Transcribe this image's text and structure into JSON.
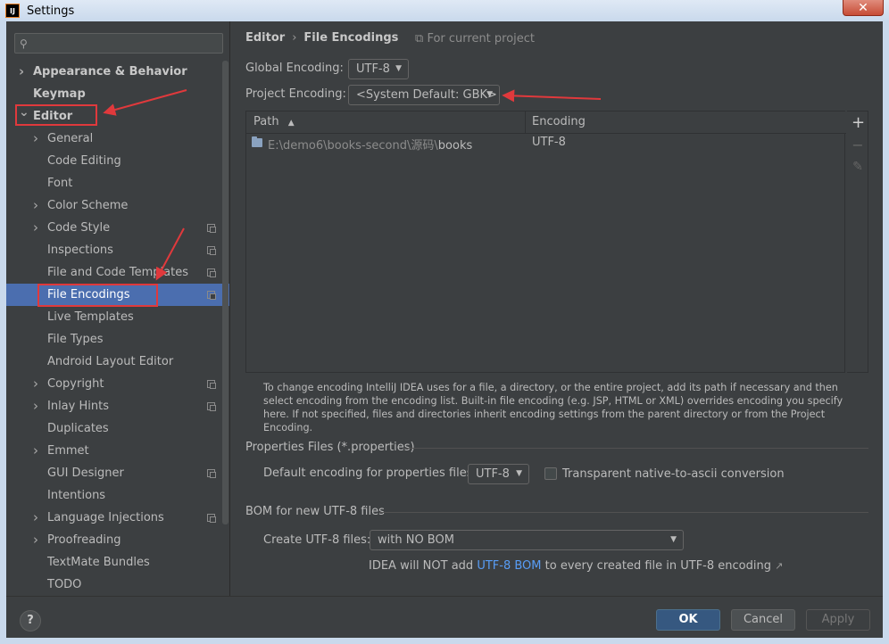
{
  "window": {
    "title": "Settings",
    "app_icon": "IJ",
    "close_label": "✕"
  },
  "search": {
    "placeholder": "",
    "icon": "search-icon"
  },
  "sidebar": {
    "items": [
      {
        "label": "Appearance & Behavior",
        "level": 0,
        "expandable": true,
        "expanded": false,
        "bold": true,
        "copy": false
      },
      {
        "label": "Keymap",
        "level": 0,
        "expandable": false,
        "bold": true,
        "copy": false
      },
      {
        "label": "Editor",
        "level": 0,
        "expandable": true,
        "expanded": true,
        "bold": true,
        "copy": false
      },
      {
        "label": "General",
        "level": 1,
        "expandable": true,
        "expanded": false,
        "copy": false
      },
      {
        "label": "Code Editing",
        "level": 1,
        "expandable": false,
        "copy": false
      },
      {
        "label": "Font",
        "level": 1,
        "expandable": false,
        "copy": false
      },
      {
        "label": "Color Scheme",
        "level": 1,
        "expandable": true,
        "expanded": false,
        "copy": false
      },
      {
        "label": "Code Style",
        "level": 1,
        "expandable": true,
        "expanded": false,
        "copy": true
      },
      {
        "label": "Inspections",
        "level": 1,
        "expandable": false,
        "copy": true
      },
      {
        "label": "File and Code Templates",
        "level": 1,
        "expandable": false,
        "copy": true
      },
      {
        "label": "File Encodings",
        "level": 1,
        "expandable": false,
        "copy": true,
        "selected": true
      },
      {
        "label": "Live Templates",
        "level": 1,
        "expandable": false,
        "copy": false
      },
      {
        "label": "File Types",
        "level": 1,
        "expandable": false,
        "copy": false
      },
      {
        "label": "Android Layout Editor",
        "level": 1,
        "expandable": false,
        "copy": false
      },
      {
        "label": "Copyright",
        "level": 1,
        "expandable": true,
        "expanded": false,
        "copy": true
      },
      {
        "label": "Inlay Hints",
        "level": 1,
        "expandable": true,
        "expanded": false,
        "copy": true
      },
      {
        "label": "Duplicates",
        "level": 1,
        "expandable": false,
        "copy": false
      },
      {
        "label": "Emmet",
        "level": 1,
        "expandable": true,
        "expanded": false,
        "copy": false
      },
      {
        "label": "GUI Designer",
        "level": 1,
        "expandable": false,
        "copy": true
      },
      {
        "label": "Intentions",
        "level": 1,
        "expandable": false,
        "copy": false
      },
      {
        "label": "Language Injections",
        "level": 1,
        "expandable": true,
        "expanded": false,
        "copy": true
      },
      {
        "label": "Proofreading",
        "level": 1,
        "expandable": true,
        "expanded": false,
        "copy": false
      },
      {
        "label": "TextMate Bundles",
        "level": 1,
        "expandable": false,
        "copy": false
      },
      {
        "label": "TODO",
        "level": 1,
        "expandable": false,
        "copy": false
      }
    ]
  },
  "main": {
    "breadcrumb": [
      "Editor",
      "File Encodings"
    ],
    "breadcrumb_sep": "›",
    "for_project": "For current project",
    "global_encoding_label": "Global Encoding:",
    "global_encoding_value": "UTF-8",
    "project_encoding_label": "Project Encoding:",
    "project_encoding_value": "<System Default: GBK>",
    "table": {
      "columns": [
        "Path",
        "Encoding"
      ],
      "sort_indicator": "▲",
      "rows": [
        {
          "path_dim": "E:\\demo6\\books-second\\源码\\",
          "path_main": "books",
          "encoding": "UTF-8"
        }
      ]
    },
    "toolbar": {
      "add": "+",
      "remove": "−",
      "edit": "✎"
    },
    "description": "To change encoding IntelliJ IDEA uses for a file, a directory, or the entire project, add its path if necessary and then select encoding from the encoding list. Built-in file encoding (e.g. JSP, HTML or XML) overrides encoding you specify here. If not specified, files and directories inherit encoding settings from the parent directory or from the Project Encoding.",
    "properties": {
      "title": "Properties Files (*.properties)",
      "default_label": "Default encoding for properties files:",
      "default_value": "UTF-8",
      "transparent_label": "Transparent native-to-ascii conversion",
      "transparent_checked": false
    },
    "bom": {
      "title": "BOM for new UTF-8 files",
      "create_label": "Create UTF-8 files:",
      "create_value": "with NO BOM",
      "note_prefix": "IDEA will NOT add ",
      "note_link": "UTF-8 BOM",
      "note_suffix": " to every created file in UTF-8 encoding",
      "note_icon": "↗"
    }
  },
  "buttons": {
    "help": "?",
    "ok": "OK",
    "cancel": "Cancel",
    "apply": "Apply"
  },
  "colors": {
    "panel_bg": "#3c3f41",
    "selection": "#4b6eaf",
    "primary_button": "#365880",
    "link": "#589df6",
    "annotation_red": "#e0393c"
  }
}
